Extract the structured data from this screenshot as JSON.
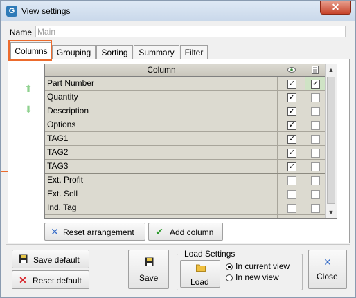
{
  "window": {
    "title": "View settings",
    "app_icon": "G",
    "close_glyph": "✕"
  },
  "name_field": {
    "label": "Name",
    "value": "Main"
  },
  "tabs": [
    {
      "label": "Columns",
      "active": true
    },
    {
      "label": "Grouping",
      "active": false
    },
    {
      "label": "Sorting",
      "active": false
    },
    {
      "label": "Summary",
      "active": false
    },
    {
      "label": "Filter",
      "active": false
    }
  ],
  "grid": {
    "header": {
      "column": "Column",
      "visible_icon": "eye-icon",
      "filter_icon": "list-icon"
    },
    "rows": [
      {
        "label": "Part Number",
        "visible": true,
        "second": true
      },
      {
        "label": "Quantity",
        "visible": true,
        "second": false
      },
      {
        "label": "Description",
        "visible": true,
        "second": false
      },
      {
        "label": "Options",
        "visible": true,
        "second": false
      },
      {
        "label": "TAG1",
        "visible": true,
        "second": false
      },
      {
        "label": "TAG2",
        "visible": true,
        "second": false
      },
      {
        "label": "TAG3",
        "visible": true,
        "second": false
      },
      {
        "label": "Ext. Profit",
        "visible": false,
        "second": false
      },
      {
        "label": "Ext. Sell",
        "visible": false,
        "second": false
      },
      {
        "label": "Ind. Tag",
        "visible": false,
        "second": false
      },
      {
        "label": "List",
        "visible": false,
        "second": false
      }
    ]
  },
  "buttons": {
    "reset_arrangement": "Reset arrangement",
    "add_column": "Add column",
    "save_default": "Save default",
    "reset_default": "Reset default",
    "save": "Save",
    "load": "Load",
    "close": "Close"
  },
  "load_settings": {
    "title": "Load Settings",
    "options": [
      {
        "label": "In current view",
        "selected": true
      },
      {
        "label": "In new view",
        "selected": false
      }
    ]
  },
  "colors": {
    "accent_orange": "#ec6b2d",
    "grid_row": "#dcdad0",
    "highlight_green": "#cfe3c5"
  }
}
